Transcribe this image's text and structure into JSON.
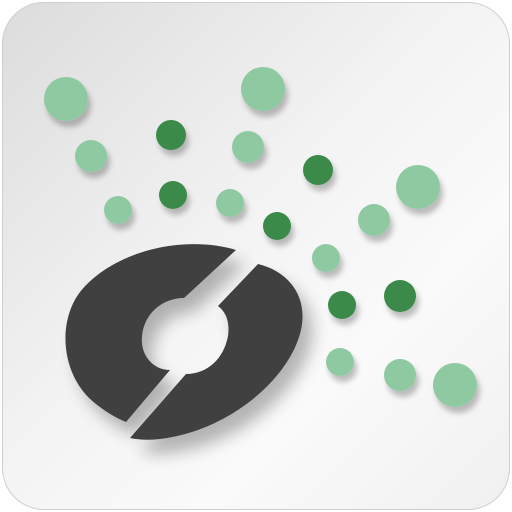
{
  "app_icon": {
    "name": "circular-logo-with-dots",
    "colors": {
      "tile_background": "#f0f0f0",
      "logo": "#3f3f3f",
      "dot_light": "#8fc9a2",
      "dot_dark": "#3a8a4a"
    }
  }
}
